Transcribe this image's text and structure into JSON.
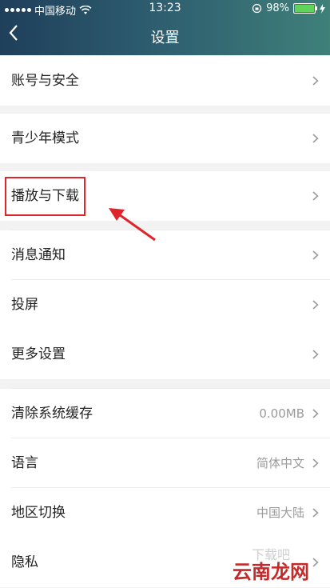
{
  "status_bar": {
    "carrier": "中国移动",
    "time": "13:23",
    "battery": "98%",
    "battery_level": 0.98
  },
  "header": {
    "back_icon": "chevron-left-icon",
    "title": "设置"
  },
  "settings": [
    {
      "label": "账号与安全",
      "value": ""
    },
    {
      "label": "青少年模式",
      "value": ""
    },
    {
      "label": "播放与下载",
      "value": ""
    },
    {
      "label": "消息通知",
      "value": ""
    },
    {
      "label": "投屏",
      "value": ""
    },
    {
      "label": "更多设置",
      "value": ""
    },
    {
      "label": "清除系统缓存",
      "value": "0.00MB"
    },
    {
      "label": "语言",
      "value": "简体中文"
    },
    {
      "label": "地区切换",
      "value": "中国大陆"
    },
    {
      "label": "隐私",
      "value": ""
    }
  ],
  "watermark": {
    "text": "云南龙网",
    "sub": "下载吧"
  },
  "colors": {
    "highlight": "#e0242b",
    "header_start": "#1f3f5a",
    "header_end": "#3f8079"
  }
}
